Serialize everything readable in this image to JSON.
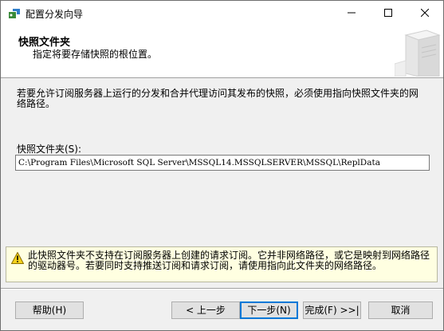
{
  "window": {
    "title": "配置分发向导",
    "icons": {
      "app": "wizard-app-icon",
      "minimize": "minimize-icon",
      "maximize": "maximize-icon",
      "close": "close-icon"
    }
  },
  "header": {
    "title": "快照文件夹",
    "subtitle": "指定将要存储快照的根位置。",
    "image_icon": "server-tower-icon"
  },
  "main": {
    "description": "若要允许订阅服务器上运行的分发和合并代理访问其发布的快照，必须使用指向快照文件夹的网络路径。",
    "folder_label": "快照文件夹(S):",
    "folder_value": "C:\\Program Files\\Microsoft SQL Server\\MSSQL14.MSSQLSERVER\\MSSQL\\ReplData"
  },
  "warning": {
    "icon": "warning-icon",
    "text": "此快照文件夹不支持在订阅服务器上创建的请求订阅。它并非网络路径，或它是映射到网络路径的驱动器号。若要同时支持推送订阅和请求订阅，请使用指向此文件夹的网络路径。"
  },
  "buttons": {
    "help": "帮助(H)",
    "back": "< 上一步",
    "next": "下一步(N)",
    "finish": "完成(F) >>|",
    "cancel": "取消"
  }
}
